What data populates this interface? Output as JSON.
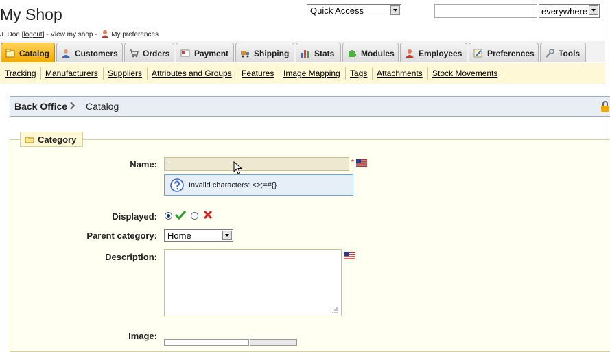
{
  "header": {
    "shop_title": "My Shop",
    "user_name": "J. Doe [",
    "logout": "logout",
    "after_logout": "] - View my shop -",
    "preferences_link": "My preferences",
    "quick_access": "Quick Access",
    "search_value": "",
    "search_scope": "everywhere"
  },
  "tabs": [
    {
      "label": "Catalog",
      "icon": "catalog-icon",
      "active": true
    },
    {
      "label": "Customers",
      "icon": "customers-icon"
    },
    {
      "label": "Orders",
      "icon": "orders-icon"
    },
    {
      "label": "Payment",
      "icon": "payment-icon"
    },
    {
      "label": "Shipping",
      "icon": "shipping-icon"
    },
    {
      "label": "Stats",
      "icon": "stats-icon"
    },
    {
      "label": "Modules",
      "icon": "modules-icon"
    },
    {
      "label": "Employees",
      "icon": "employees-icon"
    },
    {
      "label": "Preferences",
      "icon": "preferences-icon"
    },
    {
      "label": "Tools",
      "icon": "tools-icon"
    }
  ],
  "subtabs": [
    "Tracking",
    "Manufacturers",
    "Suppliers",
    "Attributes and Groups",
    "Features",
    "Image Mapping",
    "Tags",
    "Attachments",
    "Stock Movements"
  ],
  "breadcrumb": {
    "root": "Back Office",
    "current": "Catalog"
  },
  "form": {
    "legend": "Category",
    "name_label": "Name:",
    "name_value": "",
    "required_mark": "*",
    "hint": "Invalid characters: <>;=#{}",
    "displayed_label": "Displayed:",
    "parent_label": "Parent category:",
    "parent_value": "Home",
    "description_label": "Description:",
    "description_value": "",
    "image_label": "Image:"
  },
  "colors": {
    "active_tab": "#f2a900",
    "subnav_bg": "#fff8d6",
    "hint_border": "#6aa0d8",
    "check_green": "#2aa02a",
    "cross_red": "#e02020"
  }
}
